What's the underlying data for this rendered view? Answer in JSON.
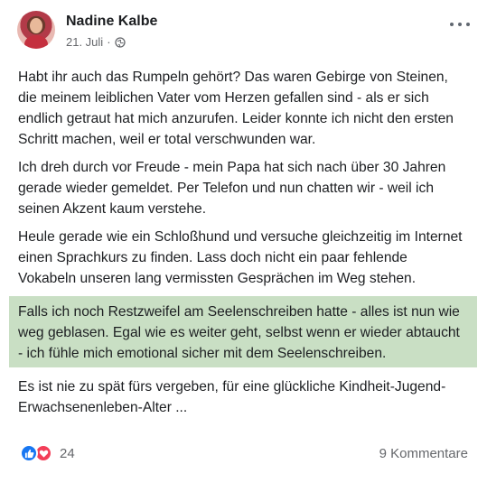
{
  "post": {
    "author": "Nadine Kalbe",
    "date": "21. Juli",
    "separator": "·",
    "audience_icon": "globe-icon",
    "paragraphs": [
      "Habt ihr auch das Rumpeln gehört?  Das waren Gebirge von Steinen, die meinem leiblichen Vater vom Herzen gefallen sind - als er sich endlich getraut hat mich anzurufen. Leider konnte ich nicht den ersten Schritt machen, weil er total verschwunden war.",
      "Ich dreh durch vor Freude - mein Papa hat sich nach über 30 Jahren gerade wieder gemeldet. Per Telefon und nun chatten wir - weil ich seinen Akzent kaum verstehe.",
      "Heule gerade wie ein Schloßhund und versuche gleichzeitig im Internet einen Sprachkurs zu finden. Lass doch nicht ein paar fehlende Vokabeln unseren lang vermissten Gesprächen im Weg stehen.",
      "Falls ich noch Restzweifel am Seelenschreiben hatte - alles ist nun wie weg geblasen. Egal wie es weiter geht, selbst wenn er wieder abtaucht - ich fühle mich emotional sicher mit dem Seelenschreiben.",
      "Es ist nie zu spät fürs vergeben, für eine glückliche Kindheit-Jugend-Erwachsenenleben-Alter ..."
    ],
    "highlight_color": "#c9dfc4"
  },
  "footer": {
    "reaction_icons": [
      "like-icon",
      "love-icon"
    ],
    "reaction_count": "24",
    "comments": "9 Kommentare"
  },
  "colors": {
    "like": "#1877f2",
    "love": "#f33e58",
    "secondary_text": "#65676b"
  }
}
